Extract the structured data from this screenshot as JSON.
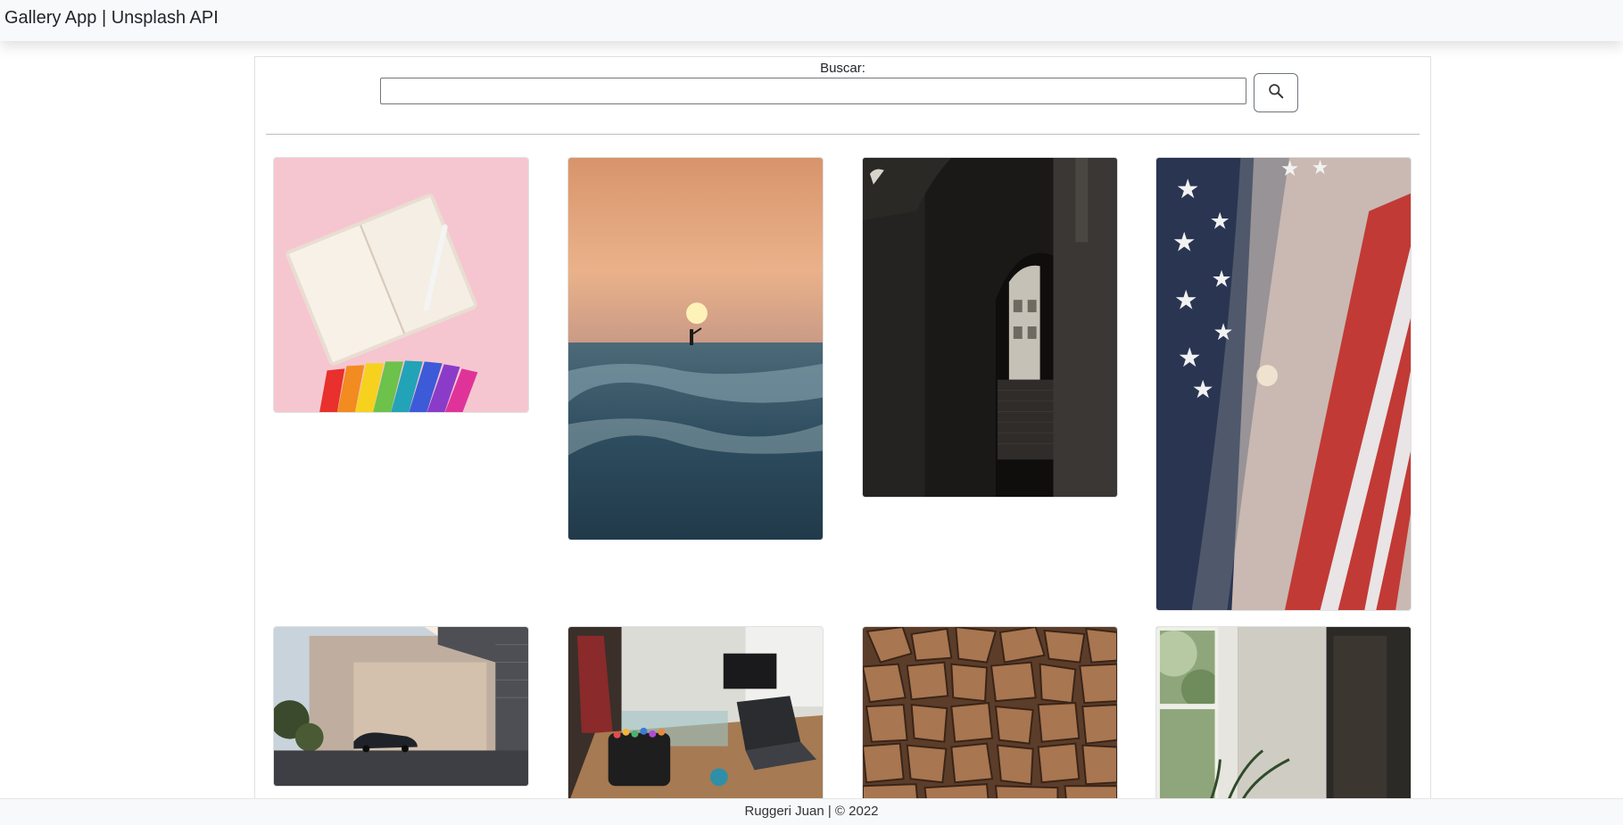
{
  "navbar": {
    "brand": "Gallery App | Unsplash API"
  },
  "search": {
    "label": "Buscar:",
    "value": "",
    "button_icon": "search-icon"
  },
  "gallery": {
    "photos": [
      {
        "subject": "notebook-and-color-swatches"
      },
      {
        "subject": "surfer-at-sunset"
      },
      {
        "subject": "stone-archway-corridor"
      },
      {
        "subject": "american-flag"
      },
      {
        "subject": "modern-building-with-car"
      },
      {
        "subject": "desk-with-laptop-and-markers"
      },
      {
        "subject": "stacked-firewood"
      },
      {
        "subject": "window-with-plant"
      }
    ]
  },
  "footer": {
    "text": "Ruggeri Juan | © 2022"
  },
  "colors": {
    "navbar_bg": "#f8f9fa",
    "border": "#dee2e6",
    "text": "#212529"
  }
}
